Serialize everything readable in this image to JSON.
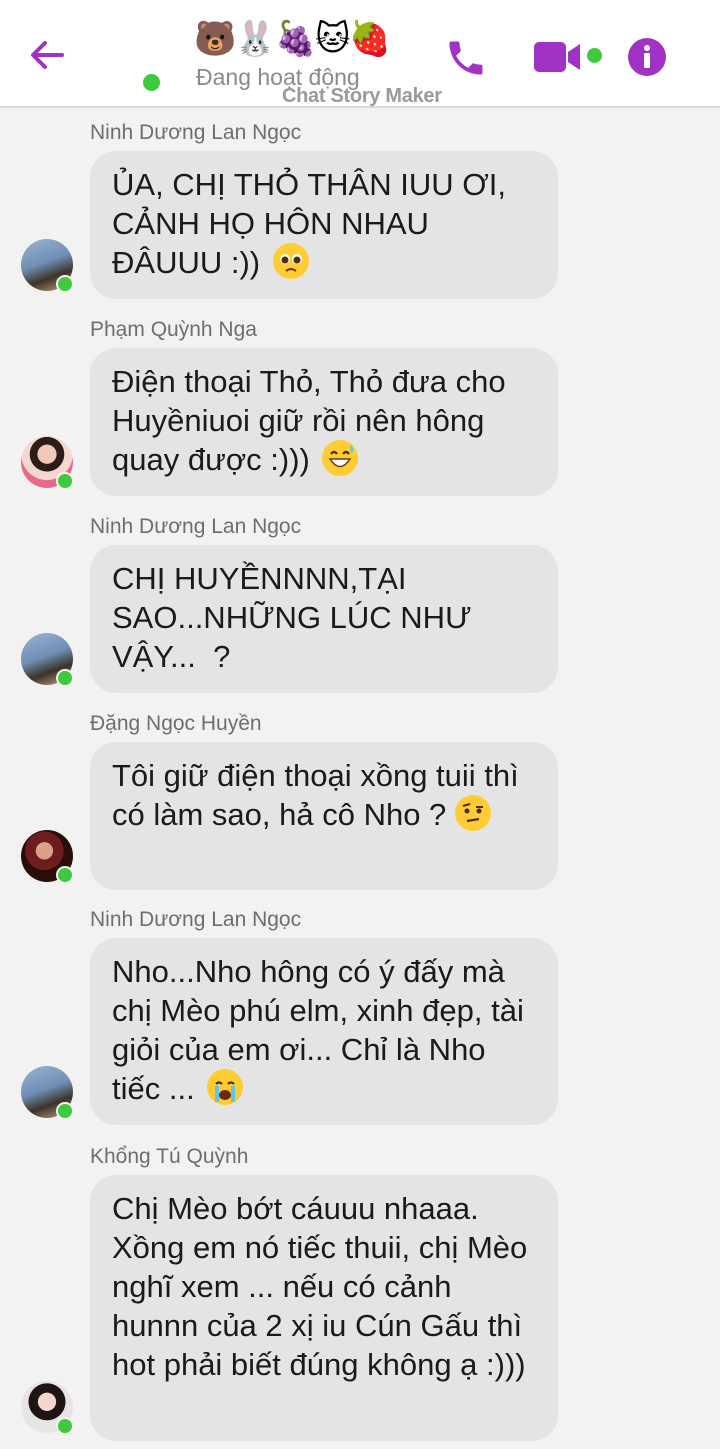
{
  "header": {
    "title_emojis": "🐻🐰🍇🐱🍓",
    "status": "Đang hoạt động",
    "watermark": "Chat Story Maker"
  },
  "colors": {
    "accent": "#a033c4",
    "online": "#3ec93e",
    "bubble": "#e4e4e4",
    "background": "#f2f2f2"
  },
  "messages": [
    {
      "sender": "Ninh Dương Lan Ngọc",
      "text": "ỦA, CHỊ THỎ THÂN IUU ƠI, CẢNH HỌ HÔN NHAU ĐÂUUU :))",
      "emoji": "pleading-face"
    },
    {
      "sender": "Phạm Quỳnh Nga",
      "text": "Điện thoại Thỏ, Thỏ đưa cho Huyềniuoi giữ rồi nên hông quay được :)))",
      "emoji": "grinning-sweat-face"
    },
    {
      "sender": "Ninh Dương Lan Ngọc",
      "text": "CHỊ HUYỀNNNN,TẠI SAO...NHỮNG LÚC NHƯ VẬY...  ?",
      "emoji": ""
    },
    {
      "sender": "Đặng Ngọc Huyền",
      "text": "Tôi giữ điện thoại xồng tuii thì có làm sao, hả cô Nho ?",
      "emoji": "raised-eyebrow-face"
    },
    {
      "sender": "Ninh Dương Lan Ngọc",
      "text": "Nho...Nho hông có ý đấy mà chị Mèo phú elm, xinh đẹp, tài giỏi của em ơi... Chỉ là Nho tiếc ...",
      "emoji": "crying-face"
    },
    {
      "sender": "Khổng Tú Quỳnh",
      "text": "Chị Mèo bớt cáuuu nhaaa. Xồng em nó tiếc thuii, chị Mèo nghĩ xem ... nếu có cảnh hunnn của 2 xị iu Cún Gấu thì hot phải biết đúng không ạ :)))",
      "emoji": ""
    }
  ]
}
